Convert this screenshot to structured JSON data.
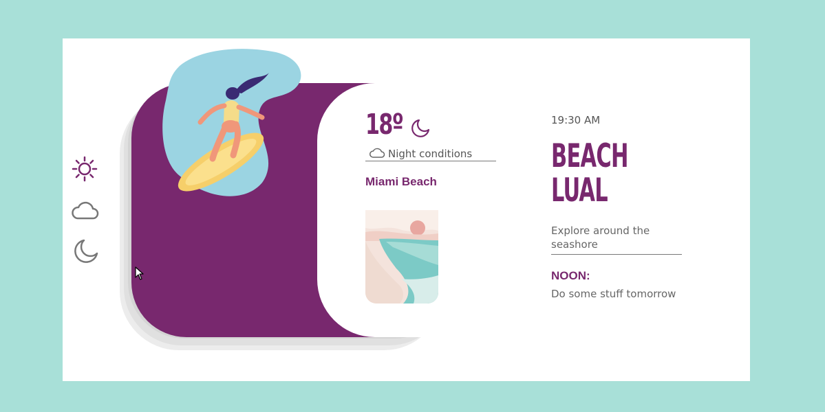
{
  "mode_icons": [
    "sun-icon",
    "cloud-icon",
    "moon-icon"
  ],
  "weather": {
    "temperature": "18º",
    "condition": "Night conditions",
    "location": "Miami Beach"
  },
  "event": {
    "time": "19:30 AM",
    "title_line1": "BEACH",
    "title_line2": "LUAL",
    "description": "Explore around the seashore",
    "noon_label": "NOON:",
    "noon_text": "Do some stuff tomorrow"
  },
  "colors": {
    "background": "#a8e0d8",
    "accent": "#78286e",
    "card": "#ffffff"
  }
}
